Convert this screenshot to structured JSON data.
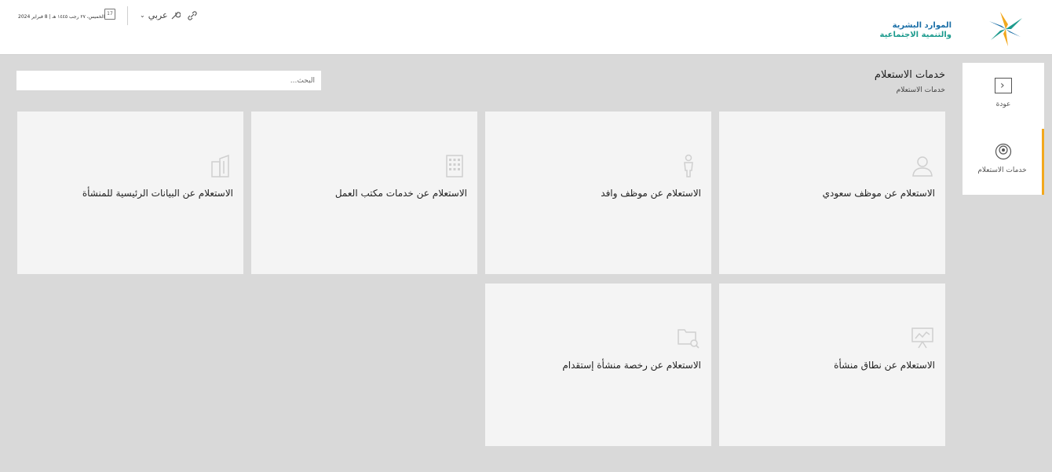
{
  "header": {
    "logo_line1": "الموارد البشرية",
    "logo_line2": "والتنمية الاجتماعية",
    "date": "الخميس، ٢٧ رجب ١٤٤٥ هـ | 8 فبراير 2024",
    "calendar_day": "17",
    "language": "عربي"
  },
  "sidebar": {
    "items": [
      {
        "label": "عودة",
        "icon": "chevron-left-icon"
      },
      {
        "label": "خدمات الاستعلام",
        "icon": "inquiry-icon",
        "active": true
      }
    ]
  },
  "main": {
    "title": "خدمات الاستعلام",
    "breadcrumb": "خدمات الاستعلام",
    "search_placeholder": "البحث...",
    "cards": [
      {
        "title": "الاستعلام عن موظف سعودي",
        "icon": "user-icon"
      },
      {
        "title": "الاستعلام عن موظف وافد",
        "icon": "person-icon"
      },
      {
        "title": "الاستعلام عن خدمات مكتب العمل",
        "icon": "building-icon"
      },
      {
        "title": "الاستعلام عن البيانات الرئيسية للمنشأة",
        "icon": "buildings-icon"
      },
      {
        "title": "الاستعلام عن نطاق منشأة",
        "icon": "presentation-chart-icon"
      },
      {
        "title": "الاستعلام عن رخصة منشأة إستقدام",
        "icon": "folder-search-icon"
      }
    ]
  },
  "colors": {
    "accent": "#f2a81d",
    "background": "#d9d9d9",
    "card": "#f4f4f4"
  }
}
